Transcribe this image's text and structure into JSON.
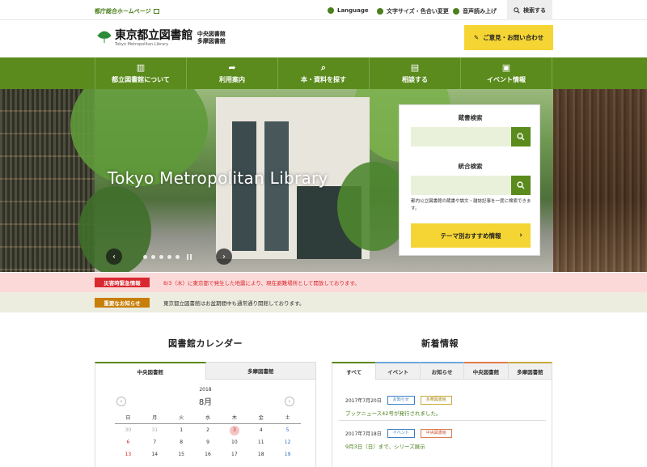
{
  "topbar": {
    "home_link": "都庁総合ホームページ",
    "language": "Language",
    "font_color": "文字サイズ・色合い変更",
    "read_aloud": "音声読み上げ",
    "search": "検索する"
  },
  "header": {
    "logo_name": "東京都立図書館",
    "logo_en": "Tokyo Metropolitan Library",
    "branch_1": "中央図書館",
    "branch_2": "多摩図書館",
    "opinion_button": "ご意見・お問い合わせ"
  },
  "nav": {
    "items": [
      {
        "label": "都立図書館について",
        "icon": "building-icon"
      },
      {
        "label": "利用案内",
        "icon": "signpost-icon"
      },
      {
        "label": "本・資料を探す",
        "icon": "book-search-icon"
      },
      {
        "label": "相談する",
        "icon": "chat-icon"
      },
      {
        "label": "イベント情報",
        "icon": "calendar-icon"
      }
    ]
  },
  "hero": {
    "title": "Tokyo Metropolitan Library",
    "prev": "‹",
    "next": "›"
  },
  "search_panel": {
    "catalog_label": "蔵書検索",
    "unified_label": "統合検索",
    "unified_desc": "都内公立図書館の蔵書や論文・雑誌記事を一度に検索できます。",
    "theme_button": "テーマ別おすすめ情報"
  },
  "alerts": [
    {
      "tag": "災害時緊急情報",
      "message": "8/3（木）に東京都で発生した地震により、現在避難場所として開放しております。",
      "tag_color": "#d9282f",
      "bg": "#fbd9d9",
      "text_color": "#d9282f"
    },
    {
      "tag": "重要なお知らせ",
      "message": "東京都立図書館はお盆期間中も通常通り開館しております。",
      "tag_color": "#c77f0a",
      "bg": "#ececdf",
      "text_color": "#333333"
    }
  ],
  "calendar": {
    "title": "図書館カレンダー",
    "tabs": [
      "中央図書館",
      "多摩図書館"
    ],
    "year": "2018",
    "month": "8月",
    "weekdays": [
      "日",
      "月",
      "火",
      "水",
      "木",
      "金",
      "土"
    ],
    "weeks": [
      [
        "30",
        "31",
        "1",
        "2",
        "3",
        "4",
        "5"
      ],
      [
        "6",
        "7",
        "8",
        "9",
        "10",
        "11",
        "12"
      ],
      [
        "13",
        "14",
        "15",
        "16",
        "17",
        "18",
        "19"
      ]
    ]
  },
  "news": {
    "title": "新着情報",
    "tabs": [
      "すべて",
      "イベント",
      "お知らせ",
      "中央図書館",
      "多摩図書館"
    ],
    "items": [
      {
        "date": "2017年7月20日",
        "badge1": "お知らせ",
        "badge2": "多摩図書館",
        "title": "ブックニュース42号が発行されました。"
      },
      {
        "date": "2017年7月18日",
        "badge1": "イベント",
        "badge2": "中央図書館",
        "title": "9月3日（日）まで、シリーズ展示"
      }
    ]
  },
  "colors": {
    "brand_green": "#5a8b1c",
    "accent_yellow": "#f5d533"
  }
}
